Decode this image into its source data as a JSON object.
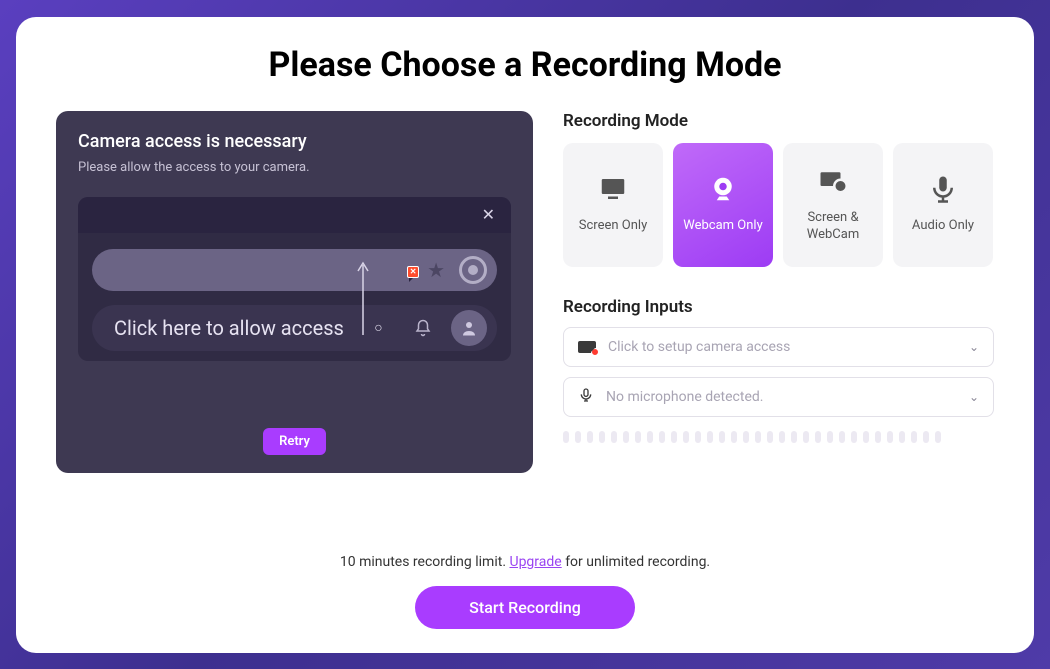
{
  "page_title": "Please Choose a Recording Mode",
  "preview": {
    "title": "Camera access is necessary",
    "subtitle": "Please allow the access to your camera.",
    "hint_text": "Click here to allow access",
    "retry_label": "Retry"
  },
  "recording_mode_heading": "Recording Mode",
  "modes": {
    "screen_only": "Screen Only",
    "webcam_only": "Webcam Only",
    "screen_webcam": "Screen & WebCam",
    "audio_only": "Audio Only"
  },
  "active_mode": "webcam_only",
  "recording_inputs_heading": "Recording Inputs",
  "inputs": {
    "camera_placeholder": "Click to setup camera access",
    "mic_placeholder": "No microphone detected."
  },
  "footer": {
    "limit_prefix": "10 minutes recording limit. ",
    "upgrade_label": "Upgrade",
    "limit_suffix": " for unlimited recording.",
    "start_label": "Start Recording"
  }
}
